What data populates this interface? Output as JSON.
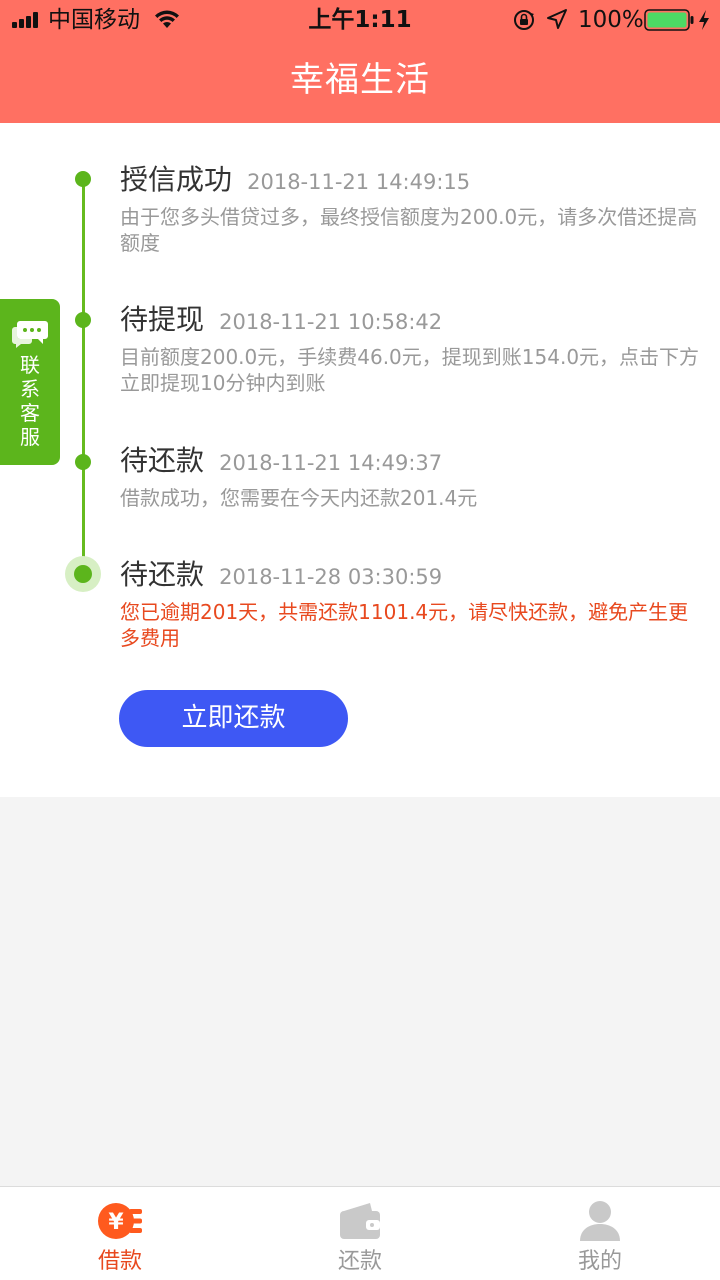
{
  "status_bar": {
    "carrier": "中国移动",
    "time": "上午1:11",
    "battery_percent": "100%",
    "icons": [
      "signal-icon",
      "wifi-icon",
      "rotation-lock-icon",
      "location-arrow-icon",
      "battery-icon",
      "charging-icon"
    ]
  },
  "header": {
    "title": "幸福生活",
    "background": "#ff7062"
  },
  "timeline": {
    "steps": [
      {
        "title": "授信成功",
        "time": "2018-11-21 14:49:15",
        "desc": "由于您多头借贷过多，最终授信额度为200.0元，请多次借还提高额度"
      },
      {
        "title": "待提现",
        "time": "2018-11-21 10:58:42",
        "desc": "目前额度200.0元，手续费46.0元，提现到账154.0元，点击下方立即提现10分钟内到账"
      },
      {
        "title": "待还款",
        "time": "2018-11-21 14:49:37",
        "desc": "借款成功，您需要在今天内还款201.4元"
      },
      {
        "title": "待还款",
        "time": "2018-11-28 03:30:59",
        "desc": "您已逾期201天，共需还款1101.4元，请尽快还款，避免产生更多费用"
      }
    ],
    "accent": "#5cb51c",
    "overdue_color": "#e8491f"
  },
  "actions": {
    "repay_now": "立即还款",
    "button_color": "#3e58f4"
  },
  "customer_service": {
    "chars": [
      "联",
      "系",
      "客",
      "服"
    ],
    "icon": "chat-bubble-icon"
  },
  "tabbar": {
    "tabs": [
      {
        "label": "借款",
        "icon": "yuan-coin-icon",
        "active": true
      },
      {
        "label": "还款",
        "icon": "wallet-icon",
        "active": false
      },
      {
        "label": "我的",
        "icon": "user-icon",
        "active": false
      }
    ],
    "active_color": "#e8491f"
  }
}
